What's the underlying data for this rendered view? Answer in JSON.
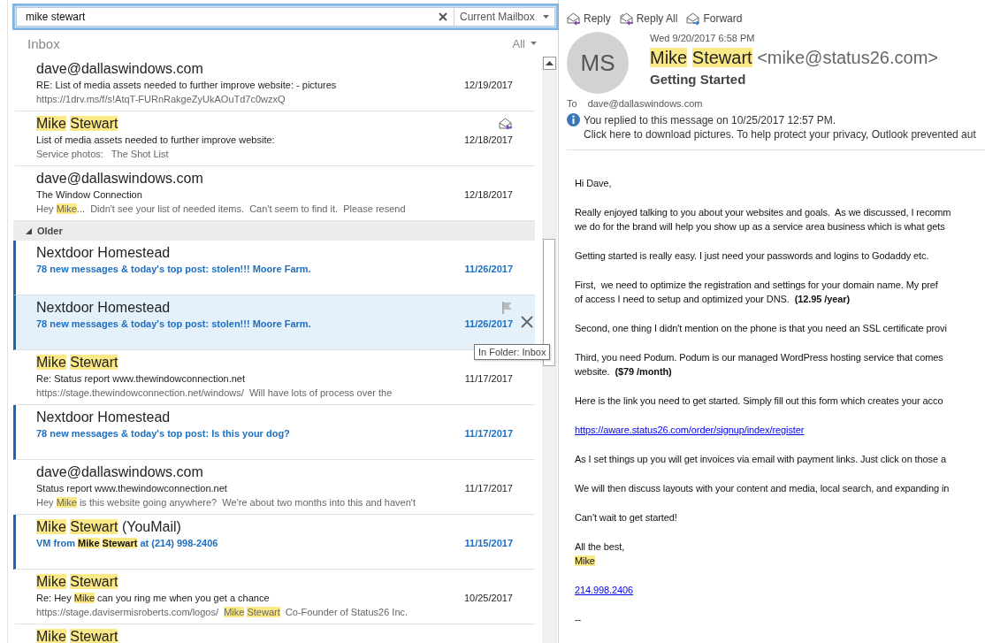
{
  "search": {
    "value": "mike stewart",
    "scope": "Current Mailbox"
  },
  "folder": {
    "title": "Inbox",
    "filter": "All"
  },
  "message_list": {
    "items": [
      {
        "kind": "message",
        "from": "dave@dallaswindows.com",
        "subject": "RE: List of media assets needed to further improve website: - pictures",
        "preview": "https://1drv.ms/f/s!AtqT-FURnRakgeZyUkAOuTd7c0wzxQ",
        "date": "12/19/2017",
        "unread": false,
        "selected": false,
        "replied": false
      },
      {
        "kind": "message",
        "from": [
          {
            "highlight": "Mike "
          },
          {
            "highlight": "Stewart"
          }
        ],
        "subject": "List of media assets needed to further improve website:",
        "preview": "Service photos:   The Shot List",
        "date": "12/18/2017",
        "unread": false,
        "selected": false,
        "replied": true
      },
      {
        "kind": "message",
        "from": "dave@dallaswindows.com",
        "subject": "The Window Connection",
        "preview": [
          "Hey ",
          {
            "highlight": "Mike"
          },
          "...  Didn't see your list of needed items.  Can't seem to find it.  Please resend"
        ],
        "date": "12/18/2017",
        "unread": false,
        "selected": false,
        "replied": false
      },
      {
        "kind": "group",
        "label": "Older",
        "expanded": true
      },
      {
        "kind": "message",
        "from": "Nextdoor Homestead",
        "subject": "78 new messages & today's top post: stolen!!! Moore Farm.",
        "date": "11/26/2017",
        "unread": true,
        "selected": false,
        "replied": false
      },
      {
        "kind": "message",
        "from": "Nextdoor Homestead",
        "subject": "78 new messages & today's top post: stolen!!! Moore Farm.",
        "date": "11/26/2017",
        "unread": true,
        "selected": true,
        "replied": false
      },
      {
        "kind": "message",
        "from": [
          {
            "highlight": "Mike "
          },
          {
            "highlight": "Stewart"
          }
        ],
        "subject": "Re: Status report www.thewindowconnection.net",
        "preview": "https://stage.thewindowconnection.net/windows/  Will have lots of process over the",
        "date": "11/17/2017",
        "unread": false,
        "selected": false,
        "replied": false
      },
      {
        "kind": "message",
        "from": "Nextdoor Homestead",
        "subject": "78 new messages & today's top post: Is this your dog?",
        "date": "11/17/2017",
        "unread": true,
        "selected": false,
        "replied": false
      },
      {
        "kind": "message",
        "from": "dave@dallaswindows.com",
        "subject": "Status report www.thewindowconnection.net",
        "preview": [
          "Hey ",
          {
            "highlight": "Mike"
          },
          " is this website going anywhere?  We're about two months into this and haven't"
        ],
        "date": "11/17/2017",
        "unread": false,
        "selected": false,
        "replied": false
      },
      {
        "kind": "message",
        "from": [
          {
            "highlight": "Mike "
          },
          {
            "highlight": "Stewart"
          },
          " (YouMail)"
        ],
        "subject": [
          "VM from ",
          {
            "highlight": "Mike "
          },
          {
            "highlight": "Stewart"
          },
          " at (214) 998-2406"
        ],
        "date": "11/15/2017",
        "unread": true,
        "selected": false,
        "replied": false
      },
      {
        "kind": "message",
        "from": [
          {
            "highlight": "Mike "
          },
          {
            "highlight": "Stewart"
          }
        ],
        "subject": [
          "Re: Hey ",
          {
            "highlight": "Mike"
          },
          " can you ring me when you get a chance"
        ],
        "preview": [
          "https://stage.davisermisroberts.com/logos/  ",
          {
            "highlight": "Mike "
          },
          {
            "highlight": "Stewart"
          },
          "  Co-Founder of Status26 Inc."
        ],
        "date": "10/25/2017",
        "unread": false,
        "selected": false,
        "replied": false
      },
      {
        "kind": "message",
        "from": [
          {
            "highlight": "Mike "
          },
          {
            "highlight": "Stewart"
          }
        ],
        "unread": false,
        "selected": false,
        "replied": false
      }
    ],
    "tooltip": "In Folder: Inbox"
  },
  "reading_pane": {
    "actions": [
      {
        "kind": "reply",
        "label": "Reply"
      },
      {
        "kind": "reply_all",
        "label": "Reply All"
      },
      {
        "kind": "forward",
        "label": "Forward"
      }
    ],
    "initials": "MS",
    "sent": "Wed 9/20/2017 6:58 PM",
    "sender": [
      {
        "highlight": "Mike "
      },
      {
        "highlight": "Stewart "
      },
      "<mike@status26.com>"
    ],
    "subject": "Getting Started",
    "to_label": "To",
    "to": "dave@dallaswindows.com",
    "info": "You replied to this message on 10/25/2017 12:57 PM.",
    "notice": "Click here to download pictures. To help protect your privacy, Outlook prevented aut",
    "body": [
      {
        "kind": "text",
        "lines": [
          "Hi Dave,"
        ]
      },
      {
        "kind": "text",
        "lines": [
          "Really enjoyed talking to you about your websites and goals.  As we discussed, I recomm",
          "we do for the brand will help you show up as a service area business which is what gets"
        ]
      },
      {
        "kind": "text",
        "lines": [
          "Getting started is really easy. I just need your passwords and logins to Godaddy etc."
        ]
      },
      {
        "kind": "text",
        "lines": [
          "First,  we need to optimize the registration and settings for your domain name. My pref",
          "of access I need to setup and optimized your DNS.  **(12.95 /year)**"
        ]
      },
      {
        "kind": "text",
        "lines": [
          "Second, one thing I didn't mention on the phone is that you need an SSL certificate provi"
        ]
      },
      {
        "kind": "text",
        "lines": [
          "Third, you need Podum. Podum is our managed WordPress hosting service that comes",
          "website.  **($79 /month)**"
        ]
      },
      {
        "kind": "text",
        "lines": [
          "Here is the link you need to get started. Simply fill out this form which creates your acco"
        ]
      },
      {
        "kind": "link",
        "lines": [
          "https://aware.status26.com/order/signup/index/register"
        ]
      },
      {
        "kind": "text",
        "lines": [
          "As I set things up you will get invoices via email with payment links. Just click on those a"
        ]
      },
      {
        "kind": "text",
        "lines": [
          "We will then discuss layouts with your content and media, local search, and expanding in"
        ]
      },
      {
        "kind": "text",
        "lines": [
          "Can't wait to get started!"
        ]
      },
      {
        "kind": "text",
        "lines": [
          "All the best,",
          [
            {
              "highlight": "Mike"
            }
          ]
        ]
      },
      {
        "kind": "link",
        "lines": [
          "214.998.2406"
        ]
      },
      {
        "kind": "text",
        "lines": [
          "--"
        ]
      }
    ]
  }
}
